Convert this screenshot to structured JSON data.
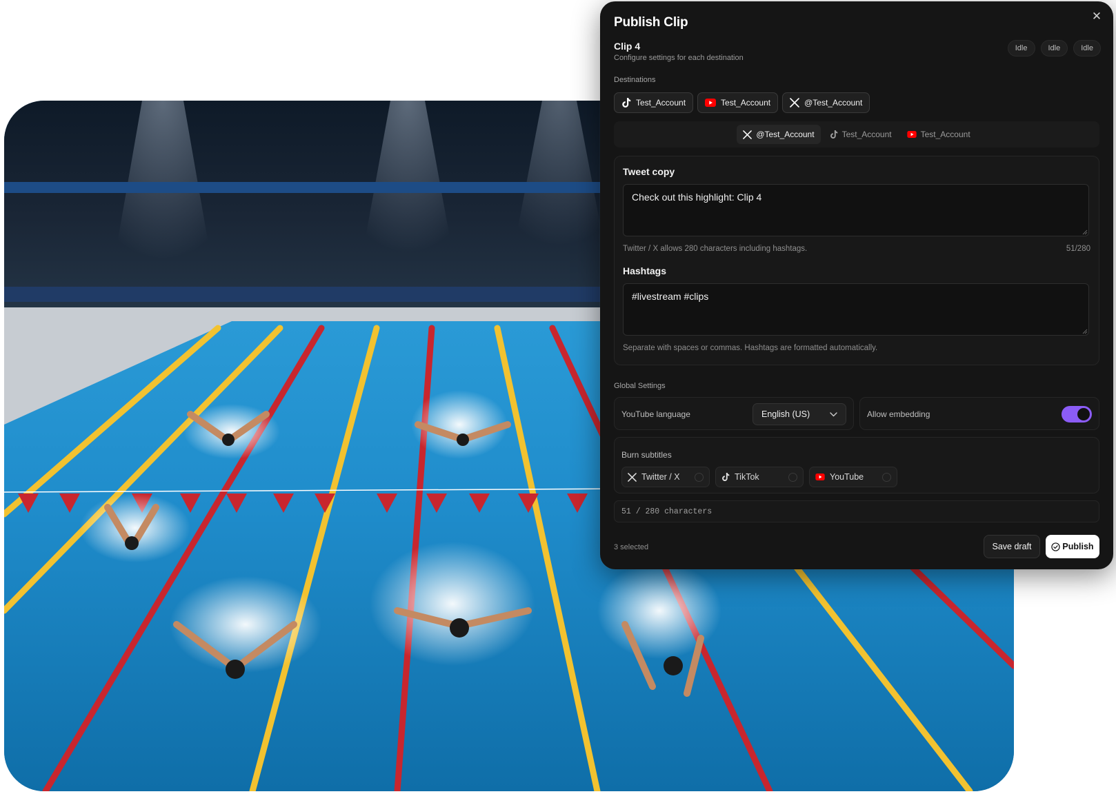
{
  "modal": {
    "title": "Publish Clip",
    "close_icon": "close-icon",
    "clip_name": "Clip 4",
    "clip_subtitle": "Configure settings for each destination",
    "statuses": [
      "Idle",
      "Idle",
      "Idle"
    ]
  },
  "destinations": {
    "label": "Destinations",
    "chips": [
      {
        "platform": "tiktok",
        "icon": "tiktok-icon",
        "label": "Test_Account"
      },
      {
        "platform": "youtube",
        "icon": "youtube-icon",
        "label": "Test_Account"
      },
      {
        "platform": "x",
        "icon": "x-icon",
        "label": "@Test_Account"
      }
    ]
  },
  "tabs": [
    {
      "platform": "x",
      "icon": "x-icon",
      "label": "@Test_Account",
      "active": true
    },
    {
      "platform": "tiktok",
      "icon": "tiktok-icon",
      "label": "Test_Account",
      "active": false
    },
    {
      "platform": "youtube",
      "icon": "youtube-icon",
      "label": "Test_Account",
      "active": false
    }
  ],
  "tweet": {
    "title": "Tweet copy",
    "value": "Check out this highlight: Clip 4",
    "hint": "Twitter / X allows 280 characters including hashtags.",
    "counter": "51/280"
  },
  "hashtags": {
    "title": "Hashtags",
    "value": "#livestream #clips",
    "hint": "Separate with spaces or commas. Hashtags are formatted automatically."
  },
  "global_settings": {
    "label": "Global Settings",
    "youtube_language_label": "YouTube language",
    "youtube_language_value": "English (US)",
    "allow_embedding_label": "Allow embedding",
    "allow_embedding_on": true
  },
  "burn_subtitles": {
    "label": "Burn subtitles",
    "options": [
      {
        "platform": "x",
        "icon": "x-icon",
        "label": "Twitter / X"
      },
      {
        "platform": "tiktok",
        "icon": "tiktok-icon",
        "label": "TikTok"
      },
      {
        "platform": "youtube",
        "icon": "youtube-icon",
        "label": "YouTube"
      }
    ]
  },
  "char_summary": "51 / 280 characters",
  "footer": {
    "selected_count": "3 selected",
    "save_draft_label": "Save draft",
    "publish_label": "Publish",
    "publish_icon": "check-circle-icon"
  },
  "colors": {
    "modal_bg": "#151515",
    "accent_toggle": "#8b5cf6",
    "youtube_red": "#ff0000",
    "lane_yellow": "#f2c230",
    "lane_red": "#c8262e",
    "pool_water": "#1d86c4"
  }
}
